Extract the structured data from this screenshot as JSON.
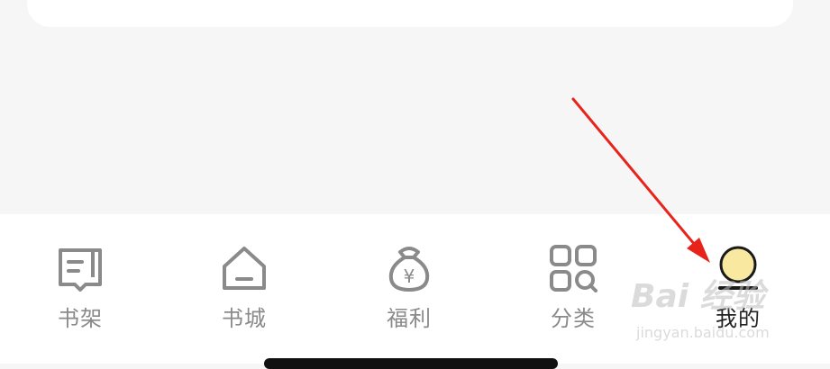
{
  "tabs": [
    {
      "id": "bookshelf",
      "label": "书架",
      "icon": "bookshelf-icon",
      "active": false
    },
    {
      "id": "bookstore",
      "label": "书城",
      "icon": "home-icon",
      "active": false
    },
    {
      "id": "welfare",
      "label": "福利",
      "icon": "money-bag-icon",
      "active": false
    },
    {
      "id": "category",
      "label": "分类",
      "icon": "category-grid-icon",
      "active": false
    },
    {
      "id": "mine",
      "label": "我的",
      "icon": "profile-icon",
      "active": true
    }
  ],
  "welfare_icon_glyph": "¥",
  "watermark": {
    "logo": "Bai 经验",
    "sub": "jingyan.baidu.com"
  },
  "colors": {
    "inactive": "#8a8a8a",
    "active": "#222222",
    "accent": "#f9e9a0",
    "arrow": "#e8231c"
  }
}
